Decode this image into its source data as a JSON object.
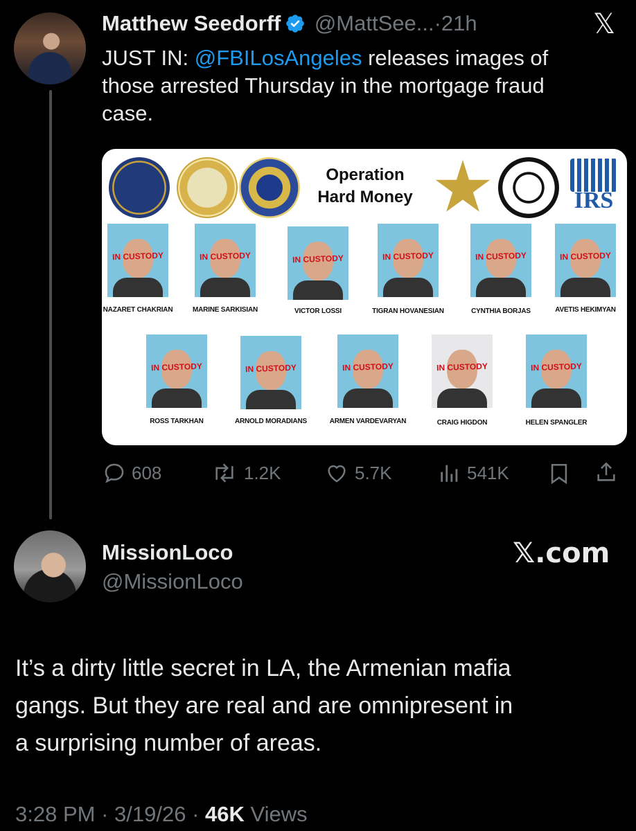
{
  "tweet1": {
    "author_name": "Matthew Seedorff",
    "handle": "@MattSee...",
    "separator": "·",
    "time": "21h",
    "text_prefix": "JUST IN: ",
    "mention": "@FBILosAngeles",
    "text_line1_rest": " releases images of",
    "text_line2": "those arrested Thursday in the mortgage fraud",
    "text_line3": "case.",
    "x_logo": "𝕏",
    "card": {
      "title_line1": "Operation",
      "title_line2": "Hard Money",
      "irs_label": "IRS",
      "stamp_text": "IN CUSTODY",
      "row1": [
        "NAZARET CHAKRIAN",
        "MARINE SARKISIAN",
        "VICTOR LOSSI",
        "TIGRAN HOVANESIAN",
        "CYNTHIA BORJAS",
        "AVETIS HEKIMYAN"
      ],
      "row2": [
        "ROSS TARKHAN",
        "ARNOLD MORADIANS",
        "ARMEN VARDEVARYAN",
        "CRAIG HIGDON",
        "HELEN SPANGLER"
      ]
    },
    "metrics": {
      "replies": "608",
      "reposts": "1.2K",
      "likes": "5.7K",
      "views": "541K"
    }
  },
  "tweet2": {
    "author_name": "MissionLoco",
    "handle": "@MissionLoco",
    "watermark": "𝕏.com",
    "text_line1": "It’s a dirty little secret in LA, the Armenian mafia",
    "text_line2": "gangs.  But they are real and are omnipresent in",
    "text_line3": "a surprising number of areas.",
    "footer_time": "3:28 PM",
    "footer_sep1": " · ",
    "footer_date": "3/19/26",
    "footer_sep2": " · ",
    "footer_views": "46K",
    "footer_views_label": " Views"
  },
  "colors": {
    "accent": "#1d9bf0",
    "muted": "#71767b",
    "stamp": "#d0101a"
  }
}
